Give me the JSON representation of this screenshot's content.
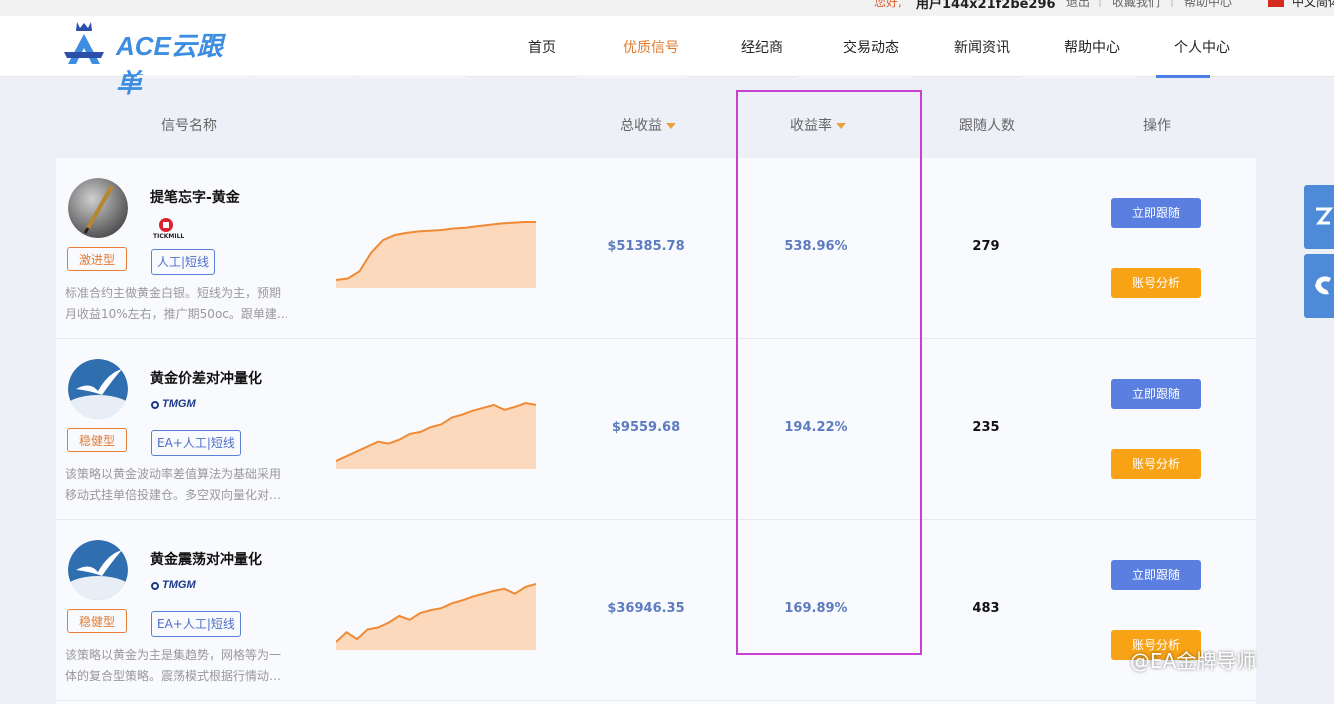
{
  "topbar": {
    "greeting": "您好,",
    "user": "用户144x21f2be296",
    "logout": "退出",
    "favorite": "收藏我们",
    "help": "帮助中心",
    "language": "中文简体",
    "separator": "|"
  },
  "brand": {
    "logo_text": "ACE云跟单",
    "color": "#3d8de0"
  },
  "nav": {
    "items": [
      "首页",
      "优质信号",
      "经纪商",
      "交易动态",
      "新闻资讯",
      "帮助中心",
      "个人中心"
    ],
    "active_index": 1,
    "active_color": "#e07a2e"
  },
  "table": {
    "headers": {
      "name": "信号名称",
      "profit": "总收益",
      "rate": "收益率",
      "followers": "跟随人数",
      "actions": "操作"
    },
    "sort_icon": "caret-down-icon"
  },
  "signals": [
    {
      "name": "提笔忘字-黄金",
      "broker_logo": "TICKMILL",
      "risk": "激进型",
      "type": "人工|短线",
      "desc_line1": "标准合约主做黄金白银。短线为主，预期",
      "desc_line2": "月收益10%左右，推广期50oc。跟单建…",
      "profit": "$51385.78",
      "rate": "538.96%",
      "followers": "279",
      "follow_label": "立即跟随",
      "analyze_label": "账号分析",
      "trend": [
        0,
        2,
        12,
        38,
        55,
        62,
        65,
        67,
        68,
        69,
        71,
        72,
        74,
        76,
        78,
        79,
        80,
        80
      ]
    },
    {
      "name": "黄金价差对冲量化",
      "broker_logo": "TMGM",
      "risk": "稳健型",
      "type": "EA+人工|短线",
      "desc_line1": "该策略以黄金波动率差值算法为基础采用",
      "desc_line2": "移动式挂单倍投建仓。多空双向量化对…",
      "profit": "$9559.68",
      "rate": "194.22%",
      "followers": "235",
      "follow_label": "立即跟随",
      "analyze_label": "账号分析",
      "trend": [
        0,
        5,
        10,
        15,
        20,
        18,
        22,
        28,
        30,
        35,
        38,
        45,
        48,
        52,
        55,
        58,
        53,
        56,
        60,
        58
      ]
    },
    {
      "name": "黄金震荡对冲量化",
      "broker_logo": "TMGM",
      "risk": "稳健型",
      "type": "EA+人工|短线",
      "desc_line1": "该策略以黄金为主是集趋势，网格等为一",
      "desc_line2": "体的复合型策略。震荡模式根据行情动…",
      "profit": "$36946.35",
      "rate": "169.89%",
      "followers": "483",
      "follow_label": "立即跟随",
      "analyze_label": "账号分析",
      "trend": [
        5,
        15,
        8,
        18,
        20,
        25,
        32,
        28,
        35,
        38,
        40,
        45,
        48,
        52,
        55,
        58,
        60,
        55,
        62,
        65
      ]
    }
  ],
  "watermark": "@EA金牌导师"
}
